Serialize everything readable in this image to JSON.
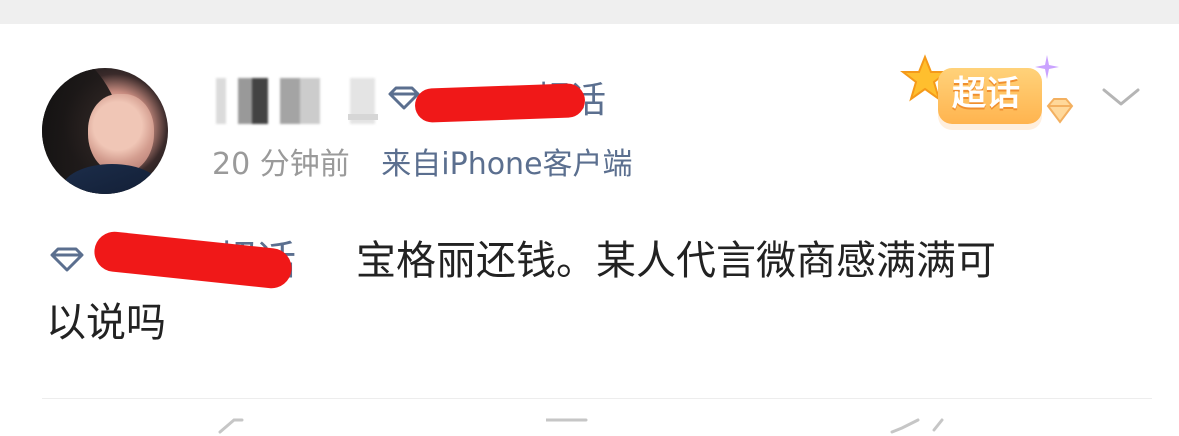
{
  "post": {
    "time_ago": "20 分钟前",
    "source_prefix": "来自",
    "source": "iPhone客户端",
    "super_topic_suffix": "超话",
    "content_text_line1": "宝格丽还钱。某人代言微商感满满可",
    "content_text_line2": "以说吗",
    "badge_label": "超话"
  },
  "colors": {
    "link_blue": "#5b6f8f",
    "meta_gray": "#9a9a9a",
    "text": "#222222",
    "redaction": "#f01818",
    "badge_orange": "#ffb44f"
  },
  "icons": {
    "diamond": "diamond-icon",
    "chevron": "chevron-down-icon",
    "badge": "super-topic-badge-icon"
  }
}
